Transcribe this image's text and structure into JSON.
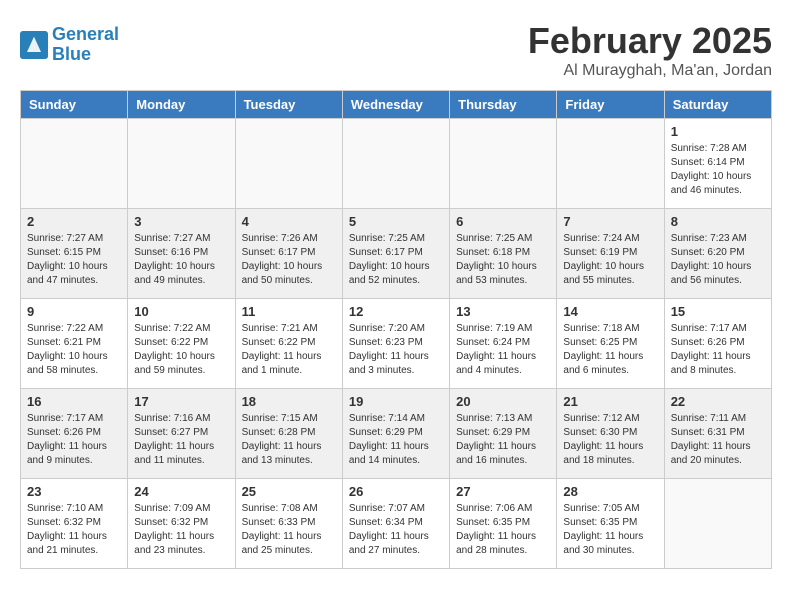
{
  "header": {
    "logo_line1": "General",
    "logo_line2": "Blue",
    "month": "February 2025",
    "location": "Al Murayghah, Ma'an, Jordan"
  },
  "days_of_week": [
    "Sunday",
    "Monday",
    "Tuesday",
    "Wednesday",
    "Thursday",
    "Friday",
    "Saturday"
  ],
  "weeks": [
    {
      "shaded": false,
      "days": [
        {
          "num": "",
          "info": ""
        },
        {
          "num": "",
          "info": ""
        },
        {
          "num": "",
          "info": ""
        },
        {
          "num": "",
          "info": ""
        },
        {
          "num": "",
          "info": ""
        },
        {
          "num": "",
          "info": ""
        },
        {
          "num": "1",
          "info": "Sunrise: 7:28 AM\nSunset: 6:14 PM\nDaylight: 10 hours and 46 minutes."
        }
      ]
    },
    {
      "shaded": true,
      "days": [
        {
          "num": "2",
          "info": "Sunrise: 7:27 AM\nSunset: 6:15 PM\nDaylight: 10 hours and 47 minutes."
        },
        {
          "num": "3",
          "info": "Sunrise: 7:27 AM\nSunset: 6:16 PM\nDaylight: 10 hours and 49 minutes."
        },
        {
          "num": "4",
          "info": "Sunrise: 7:26 AM\nSunset: 6:17 PM\nDaylight: 10 hours and 50 minutes."
        },
        {
          "num": "5",
          "info": "Sunrise: 7:25 AM\nSunset: 6:17 PM\nDaylight: 10 hours and 52 minutes."
        },
        {
          "num": "6",
          "info": "Sunrise: 7:25 AM\nSunset: 6:18 PM\nDaylight: 10 hours and 53 minutes."
        },
        {
          "num": "7",
          "info": "Sunrise: 7:24 AM\nSunset: 6:19 PM\nDaylight: 10 hours and 55 minutes."
        },
        {
          "num": "8",
          "info": "Sunrise: 7:23 AM\nSunset: 6:20 PM\nDaylight: 10 hours and 56 minutes."
        }
      ]
    },
    {
      "shaded": false,
      "days": [
        {
          "num": "9",
          "info": "Sunrise: 7:22 AM\nSunset: 6:21 PM\nDaylight: 10 hours and 58 minutes."
        },
        {
          "num": "10",
          "info": "Sunrise: 7:22 AM\nSunset: 6:22 PM\nDaylight: 10 hours and 59 minutes."
        },
        {
          "num": "11",
          "info": "Sunrise: 7:21 AM\nSunset: 6:22 PM\nDaylight: 11 hours and 1 minute."
        },
        {
          "num": "12",
          "info": "Sunrise: 7:20 AM\nSunset: 6:23 PM\nDaylight: 11 hours and 3 minutes."
        },
        {
          "num": "13",
          "info": "Sunrise: 7:19 AM\nSunset: 6:24 PM\nDaylight: 11 hours and 4 minutes."
        },
        {
          "num": "14",
          "info": "Sunrise: 7:18 AM\nSunset: 6:25 PM\nDaylight: 11 hours and 6 minutes."
        },
        {
          "num": "15",
          "info": "Sunrise: 7:17 AM\nSunset: 6:26 PM\nDaylight: 11 hours and 8 minutes."
        }
      ]
    },
    {
      "shaded": true,
      "days": [
        {
          "num": "16",
          "info": "Sunrise: 7:17 AM\nSunset: 6:26 PM\nDaylight: 11 hours and 9 minutes."
        },
        {
          "num": "17",
          "info": "Sunrise: 7:16 AM\nSunset: 6:27 PM\nDaylight: 11 hours and 11 minutes."
        },
        {
          "num": "18",
          "info": "Sunrise: 7:15 AM\nSunset: 6:28 PM\nDaylight: 11 hours and 13 minutes."
        },
        {
          "num": "19",
          "info": "Sunrise: 7:14 AM\nSunset: 6:29 PM\nDaylight: 11 hours and 14 minutes."
        },
        {
          "num": "20",
          "info": "Sunrise: 7:13 AM\nSunset: 6:29 PM\nDaylight: 11 hours and 16 minutes."
        },
        {
          "num": "21",
          "info": "Sunrise: 7:12 AM\nSunset: 6:30 PM\nDaylight: 11 hours and 18 minutes."
        },
        {
          "num": "22",
          "info": "Sunrise: 7:11 AM\nSunset: 6:31 PM\nDaylight: 11 hours and 20 minutes."
        }
      ]
    },
    {
      "shaded": false,
      "days": [
        {
          "num": "23",
          "info": "Sunrise: 7:10 AM\nSunset: 6:32 PM\nDaylight: 11 hours and 21 minutes."
        },
        {
          "num": "24",
          "info": "Sunrise: 7:09 AM\nSunset: 6:32 PM\nDaylight: 11 hours and 23 minutes."
        },
        {
          "num": "25",
          "info": "Sunrise: 7:08 AM\nSunset: 6:33 PM\nDaylight: 11 hours and 25 minutes."
        },
        {
          "num": "26",
          "info": "Sunrise: 7:07 AM\nSunset: 6:34 PM\nDaylight: 11 hours and 27 minutes."
        },
        {
          "num": "27",
          "info": "Sunrise: 7:06 AM\nSunset: 6:35 PM\nDaylight: 11 hours and 28 minutes."
        },
        {
          "num": "28",
          "info": "Sunrise: 7:05 AM\nSunset: 6:35 PM\nDaylight: 11 hours and 30 minutes."
        },
        {
          "num": "",
          "info": ""
        }
      ]
    }
  ]
}
